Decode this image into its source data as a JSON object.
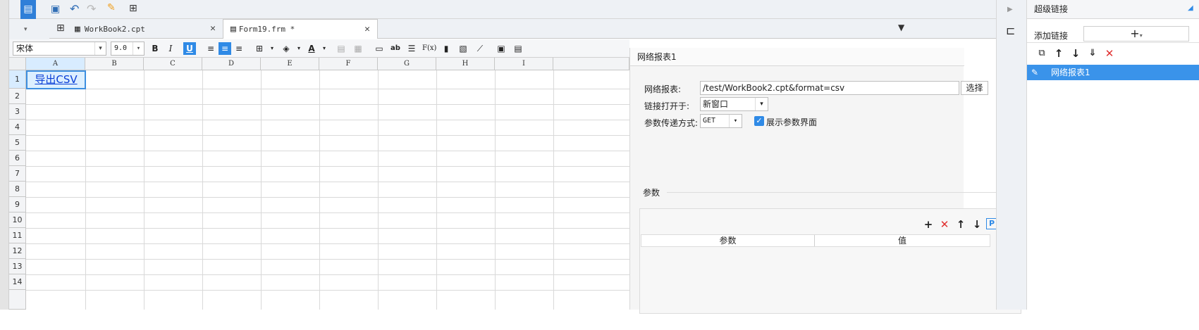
{
  "tabs": [
    {
      "label": "WorkBook2.cpt"
    },
    {
      "label": "Form19.frm *"
    }
  ],
  "format": {
    "font": "宋体",
    "size": "9.0"
  },
  "grid": {
    "columns": [
      "A",
      "B",
      "C",
      "D",
      "E",
      "F",
      "G",
      "H",
      "I"
    ],
    "rows": [
      "1",
      "2",
      "3",
      "4",
      "5",
      "6",
      "7",
      "8",
      "9",
      "10",
      "11",
      "12",
      "13",
      "14"
    ],
    "cell_a1": "导出CSV"
  },
  "link_panel": {
    "title": "网络报表1",
    "report_label": "网络报表:",
    "report_value": "/test/WorkBook2.cpt&format=csv",
    "select_button": "选择",
    "open_label": "链接打开于:",
    "open_value": "新窗口",
    "method_label": "参数传递方式:",
    "method_value": "GET",
    "show_params_label": "展示参数界面",
    "params_title": "参数",
    "param_col": "参数",
    "value_col": "值"
  },
  "right_panel": {
    "title": "超级链接",
    "add_label": "添加链接",
    "item": "网络报表1"
  }
}
